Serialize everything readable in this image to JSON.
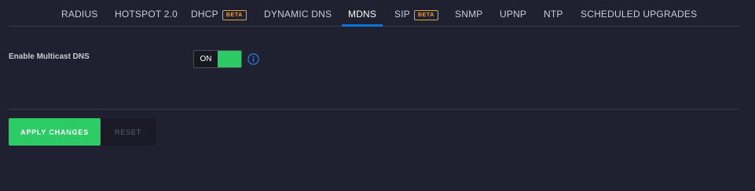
{
  "tabs": [
    {
      "label": "RADIUS"
    },
    {
      "label": "HOTSPOT 2.0"
    },
    {
      "label": "DHCP",
      "badge": "BETA"
    },
    {
      "label": "DYNAMIC DNS"
    },
    {
      "label": "MDNS",
      "active": true
    },
    {
      "label": "SIP",
      "badge": "BETA"
    },
    {
      "label": "SNMP"
    },
    {
      "label": "UPNP"
    },
    {
      "label": "NTP"
    },
    {
      "label": "SCHEDULED UPGRADES"
    }
  ],
  "setting": {
    "label": "Enable Multicast DNS",
    "toggle_state": "ON",
    "info_icon": "info-icon"
  },
  "actions": {
    "apply_label": "APPLY CHANGES",
    "reset_label": "RESET"
  },
  "colors": {
    "background": "#1f2030",
    "accent": "#2ccb66",
    "active_tab_underline": "#0a73d9",
    "beta_badge": "#e8a23a",
    "info_icon": "#2f7de1"
  }
}
